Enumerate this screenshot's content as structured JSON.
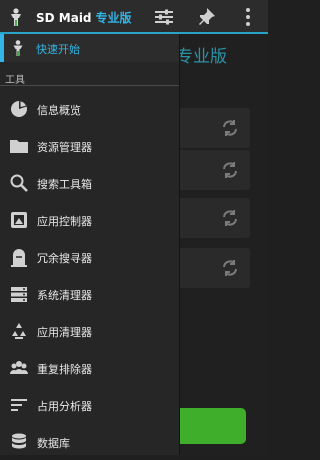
{
  "app": {
    "title": "SD Maid",
    "edition": "专业版"
  },
  "background": {
    "title": "专业版"
  },
  "drawer": {
    "quick_start": "快速开始",
    "section_tools": "工具",
    "items": [
      {
        "label": "信息概览",
        "icon": "pie-chart-icon"
      },
      {
        "label": "资源管理器",
        "icon": "folder-icon"
      },
      {
        "label": "搜索工具箱",
        "icon": "search-icon"
      },
      {
        "label": "应用控制器",
        "icon": "app-control-icon"
      },
      {
        "label": "冗余搜寻器",
        "icon": "tombstone-icon"
      },
      {
        "label": "系统清理器",
        "icon": "system-cleaner-icon"
      },
      {
        "label": "应用清理器",
        "icon": "recycle-icon"
      },
      {
        "label": "重复排除器",
        "icon": "duplicates-icon"
      },
      {
        "label": "占用分析器",
        "icon": "storage-analyzer-icon"
      },
      {
        "label": "数据库",
        "icon": "database-icon"
      }
    ]
  },
  "colors": {
    "accent": "#33b5e5",
    "button_green": "#3fae2a"
  }
}
